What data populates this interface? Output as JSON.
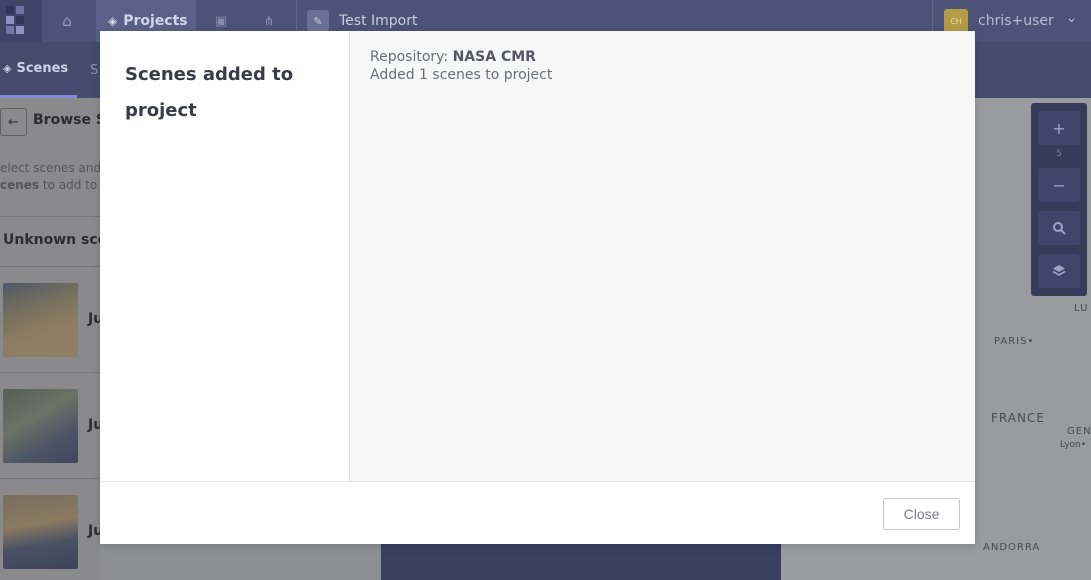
{
  "app": {
    "nav": {
      "projects_label": "Projects",
      "project_name": "Test Import",
      "user_initials": "CH",
      "user_name": "chris+user",
      "user_caret": "⌄"
    },
    "subnav": {
      "scenes_tab": "Scenes",
      "other_tab": "S"
    },
    "sidebar": {
      "back_arrow": "←",
      "browse_title": "Browse Sc",
      "hint_line1": "elect scenes and c",
      "hint_line2_bold": "cenes",
      "hint_line2_rest": " to add to th",
      "group_title": "Unknown scen",
      "scenes": [
        {
          "label": "Ju"
        },
        {
          "label": "Ju"
        },
        {
          "label": "Ju"
        }
      ]
    },
    "map": {
      "zoom_in": "+",
      "zoom_level": "5",
      "zoom_out": "−",
      "labels": {
        "paris": "PARIS•",
        "france": "FRANCE",
        "andorra": "ANDORRA",
        "lyon": "Lyon•",
        "lu": "LU",
        "gen": "GEN"
      }
    }
  },
  "modal": {
    "title": "Scenes added to project",
    "repository_prefix": "Repository: ",
    "repository_name": "NASA CMR",
    "message": "Added 1 scenes to project",
    "close_label": "Close"
  },
  "colors": {
    "topbar": "#4d5377",
    "modal_bg": "#ffffff",
    "modal_content_bg": "#f7f7f7"
  }
}
